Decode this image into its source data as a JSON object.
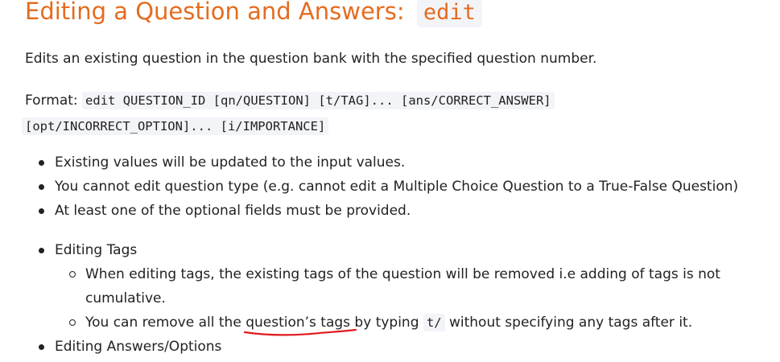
{
  "heading": {
    "text": "Editing a Question and Answers: ",
    "code": "edit"
  },
  "description": "Edits an existing question in the question bank with the specified question number.",
  "format": {
    "label": "Format:",
    "line1": "edit QUESTION_ID [qn/QUESTION] [t/TAG]... [ans/CORRECT_ANSWER]",
    "line2": "[opt/INCORRECT_OPTION]... [i/IMPORTANCE]"
  },
  "bullets": [
    "Existing values will be updated to the input values.",
    "You cannot edit question type (e.g. cannot edit a Multiple Choice Question to a True-False Question)",
    "At least one of the optional fields must be provided."
  ],
  "editing_tags": {
    "title": "Editing Tags",
    "sub1": "When editing tags, the existing tags of the question will be removed i.e adding of tags is not cumulative.",
    "sub2": {
      "before": "You can remove all the ",
      "highlight": "question’s tags",
      "middle": " by typing ",
      "code": "t/",
      "after": " without specifying any tags after it."
    }
  },
  "editing_answers": {
    "title": "Editing Answers/Options"
  },
  "colors": {
    "heading": "#e46c1f",
    "code_bg": "#f3f4f8",
    "annotation": "#e0191d"
  }
}
